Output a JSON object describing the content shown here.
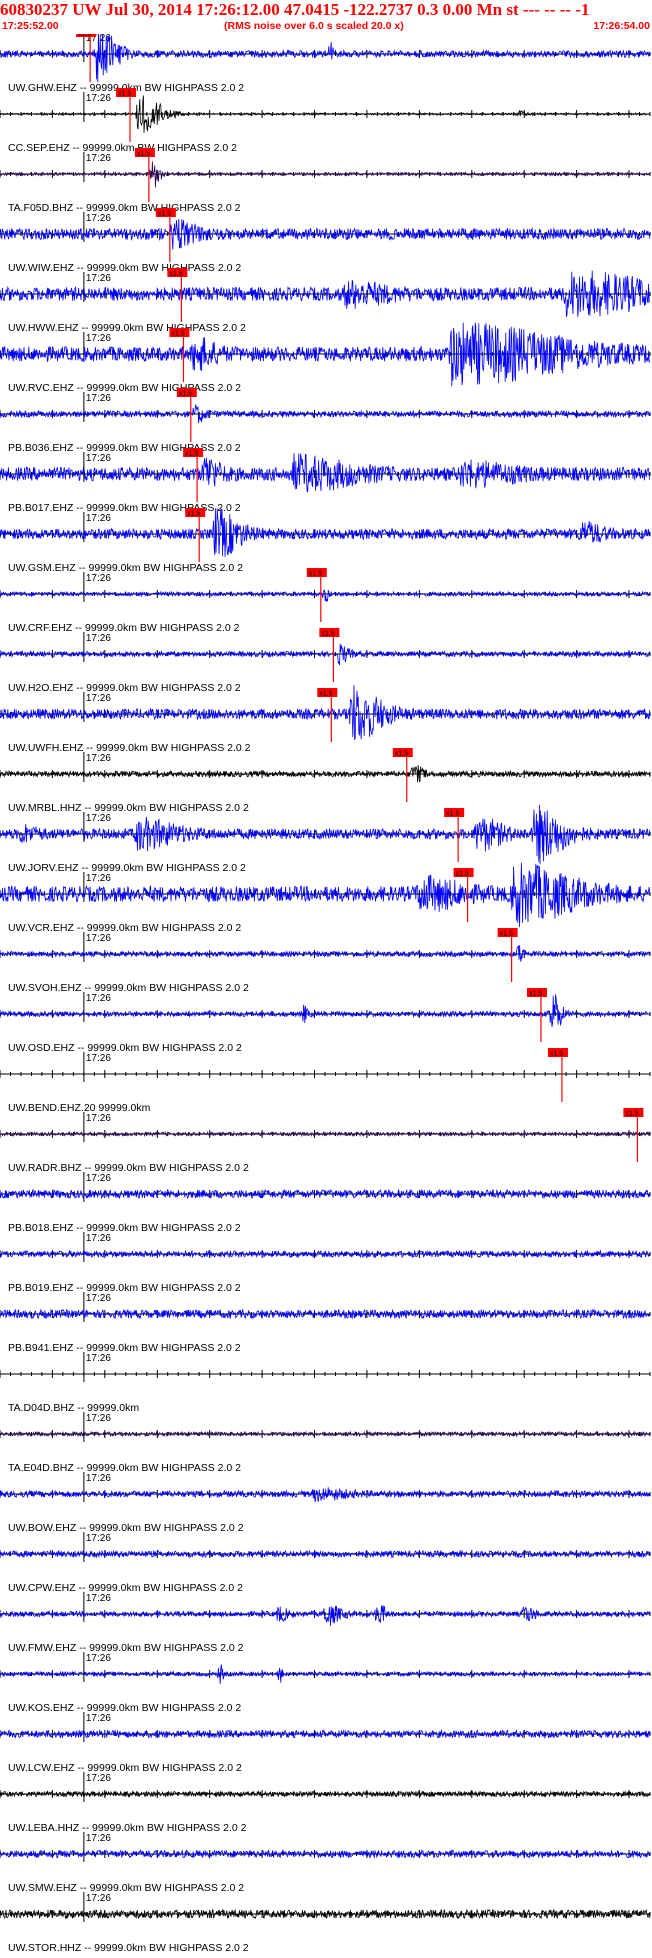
{
  "header": {
    "title": "60830237 UW Jul 30, 2014 17:26:12.00   47.0415 -122.2737  0.3 0.00 Mn st --- -- --  -1",
    "start_time": "17:25:52.00",
    "noise_note": "(RMS noise over 6.0 s scaled 20.0 x)",
    "end_time": "17:26:54.00"
  },
  "chart_data": {
    "type": "line",
    "title": "60830237 UW Jul 30, 2014 17:26:12.00   47.0415 -122.2737  0.3 0.00 Mn st --- -- --  -1",
    "x_range_seconds": [
      0,
      62
    ],
    "minute_tick_label": "17:26",
    "minute_tick_second": 8.0,
    "pick_label": "x1.5",
    "colors": {
      "blue": "#0000ff",
      "black": "#000000",
      "purple": "#2a0a5a",
      "pick": "#ff0000",
      "axis": "#000000"
    },
    "series": [
      {
        "name": "UW.GHW.EHZ -- 99999.0km BW  HIGHPASS  2.0  2",
        "color": "blue",
        "pick": 8.6,
        "noise": 0.13,
        "events": [
          {
            "t": 9.2,
            "a": 1.0,
            "d": 2.0
          },
          {
            "t": 31.5,
            "a": 0.35,
            "d": 0.4
          }
        ]
      },
      {
        "name": "CC.SEP.EHZ -- 99999.0km BW  HIGHPASS  2.0  2",
        "color": "black",
        "pick": 12.4,
        "noise": 0.04,
        "events": [
          {
            "t": 13.2,
            "a": 0.75,
            "d": 2.5
          },
          {
            "t": 49.5,
            "a": 0.08,
            "d": 1.5
          }
        ]
      },
      {
        "name": "TA.F05D.BHZ -- 99999.0km BW  HIGHPASS  2.0  2",
        "color": "purple",
        "pick": 14.2,
        "noise": 0.06,
        "events": [
          {
            "t": 14.5,
            "a": 0.55,
            "d": 0.8
          }
        ]
      },
      {
        "name": "UW.WIW.EHZ -- 99999.0km BW  HIGHPASS  2.0  2",
        "color": "blue",
        "pick": 16.2,
        "noise": 0.22,
        "events": [
          {
            "t": 16.5,
            "a": 0.45,
            "d": 2.0
          }
        ]
      },
      {
        "name": "UW.HWW.EHZ -- 99999.0km BW  HIGHPASS  2.0  2",
        "color": "blue",
        "pick": 17.3,
        "noise": 0.26,
        "events": [
          {
            "t": 54.0,
            "a": 0.7,
            "d": 9.0
          },
          {
            "t": 33.0,
            "a": 0.35,
            "d": 4.0
          }
        ]
      },
      {
        "name": "UW.RVC.EHZ -- 99999.0km BW  HIGHPASS  2.0  2",
        "color": "blue",
        "pick": 17.5,
        "noise": 0.28,
        "events": [
          {
            "t": 43.0,
            "a": 1.0,
            "d": 12.0
          },
          {
            "t": 18.5,
            "a": 0.5,
            "d": 2.0
          }
        ]
      },
      {
        "name": "PB.B036.EHZ -- 99999.0km BW  HIGHPASS  2.0  2",
        "color": "blue",
        "pick": 18.2,
        "noise": 0.12,
        "events": [
          {
            "t": 18.6,
            "a": 0.3,
            "d": 1.0
          }
        ]
      },
      {
        "name": "PB.B017.EHZ -- 99999.0km BW  HIGHPASS  2.0  2",
        "color": "blue",
        "pick": 18.8,
        "noise": 0.26,
        "events": [
          {
            "t": 28.0,
            "a": 0.55,
            "d": 6.0
          },
          {
            "t": 19.5,
            "a": 0.55,
            "d": 1.5
          },
          {
            "t": 44.0,
            "a": 0.35,
            "d": 5.0
          }
        ]
      },
      {
        "name": "UW.GSM.EHZ -- 99999.0km BW  HIGHPASS  2.0  2",
        "color": "blue",
        "pick": 19.0,
        "noise": 0.2,
        "events": [
          {
            "t": 20.5,
            "a": 0.85,
            "d": 2.5
          },
          {
            "t": 55.5,
            "a": 0.35,
            "d": 2.0
          }
        ]
      },
      {
        "name": "UW.CRF.EHZ -- 99999.0km BW  HIGHPASS  2.0  2",
        "color": "blue",
        "pick": 30.6,
        "noise": 0.08,
        "events": [
          {
            "t": 31.0,
            "a": 0.3,
            "d": 0.4
          }
        ]
      },
      {
        "name": "UW.H2O.EHZ -- 99999.0km BW  HIGHPASS  2.0  2",
        "color": "blue",
        "pick": 31.8,
        "noise": 0.1,
        "events": [
          {
            "t": 32.3,
            "a": 0.35,
            "d": 1.0
          }
        ]
      },
      {
        "name": "UW.UWFH.EHZ -- 99999.0km BW  HIGHPASS  2.0  2",
        "color": "blue",
        "pick": 31.6,
        "noise": 0.2,
        "events": [
          {
            "t": 33.5,
            "a": 1.0,
            "d": 3.0
          }
        ]
      },
      {
        "name": "UW.MRBL.HHZ -- 99999.0km BW  HIGHPASS  2.0  2",
        "color": "black",
        "pick": 38.8,
        "noise": 0.11,
        "events": [
          {
            "t": 39.4,
            "a": 0.3,
            "d": 1.0
          }
        ]
      },
      {
        "name": "UW.JORV.EHZ -- 99999.0km BW  HIGHPASS  2.0  2",
        "color": "blue",
        "pick": 43.7,
        "noise": 0.2,
        "events": [
          {
            "t": 51.0,
            "a": 1.0,
            "d": 3.0
          },
          {
            "t": 45.5,
            "a": 0.55,
            "d": 2.5
          },
          {
            "t": 13.0,
            "a": 0.5,
            "d": 4.0
          },
          {
            "t": 2.0,
            "a": 0.25,
            "d": 1.5
          }
        ]
      },
      {
        "name": "UW.VCR.EHZ -- 99999.0km BW  HIGHPASS  2.0  2",
        "color": "blue",
        "pick": 44.6,
        "noise": 0.3,
        "events": [
          {
            "t": 49.0,
            "a": 1.0,
            "d": 6.0
          },
          {
            "t": 40.0,
            "a": 0.5,
            "d": 4.0
          }
        ]
      },
      {
        "name": "UW.SVOH.EHZ -- 99999.0km BW  HIGHPASS  2.0  2",
        "color": "blue",
        "pick": 48.8,
        "noise": 0.1,
        "events": [
          {
            "t": 49.4,
            "a": 0.35,
            "d": 0.6
          }
        ]
      },
      {
        "name": "UW.OSD.EHZ -- 99999.0km BW  HIGHPASS  2.0  2",
        "color": "blue",
        "pick": 51.6,
        "noise": 0.1,
        "events": [
          {
            "t": 52.6,
            "a": 0.9,
            "d": 0.9
          },
          {
            "t": 29.0,
            "a": 0.3,
            "d": 0.4
          }
        ]
      },
      {
        "name": "UW.BEND.EHZ.20 99999.0km",
        "color": "blue",
        "pick": 53.6,
        "flat": true,
        "noise": 0.0,
        "events": []
      },
      {
        "name": "UW.RADR.BHZ -- 99999.0km BW  HIGHPASS  2.0  2",
        "color": "purple",
        "pick": 60.8,
        "noise": 0.07,
        "events": []
      },
      {
        "name": "PB.B018.EHZ -- 99999.0km BW  HIGHPASS  2.0  2",
        "color": "blue",
        "noise": 0.16,
        "events": []
      },
      {
        "name": "PB.B019.EHZ -- 99999.0km BW  HIGHPASS  2.0  2",
        "color": "blue",
        "noise": 0.12,
        "events": []
      },
      {
        "name": "PB.B941.EHZ -- 99999.0km BW  HIGHPASS  2.0  2",
        "color": "blue",
        "noise": 0.16,
        "events": []
      },
      {
        "name": "TA.D04D.BHZ -- 99999.0km",
        "color": "blue",
        "flat": true,
        "noise": 0.0,
        "events": []
      },
      {
        "name": "TA.E04D.BHZ -- 99999.0km BW  HIGHPASS  2.0  2",
        "color": "purple",
        "noise": 0.08,
        "events": []
      },
      {
        "name": "UW.BOW.EHZ -- 99999.0km BW  HIGHPASS  2.0  2",
        "color": "blue",
        "noise": 0.12,
        "events": [
          {
            "t": 30.0,
            "a": 0.2,
            "d": 3.0
          }
        ]
      },
      {
        "name": "UW.CPW.EHZ -- 99999.0km BW  HIGHPASS  2.0  2",
        "color": "blue",
        "noise": 0.12,
        "events": []
      },
      {
        "name": "UW.FMW.EHZ -- 99999.0km BW  HIGHPASS  2.0  2",
        "color": "blue",
        "noise": 0.1,
        "events": [
          {
            "t": 31.0,
            "a": 0.4,
            "d": 1.5
          },
          {
            "t": 36.0,
            "a": 0.45,
            "d": 0.7
          },
          {
            "t": 50.0,
            "a": 0.3,
            "d": 1.0
          },
          {
            "t": 26.5,
            "a": 0.25,
            "d": 1.0
          }
        ]
      },
      {
        "name": "UW.KOS.EHZ -- 99999.0km BW  HIGHPASS  2.0  2",
        "color": "blue",
        "noise": 0.08,
        "events": [
          {
            "t": 21.0,
            "a": 0.35,
            "d": 0.3
          },
          {
            "t": 26.7,
            "a": 0.3,
            "d": 0.3
          }
        ]
      },
      {
        "name": "UW.LCW.EHZ -- 99999.0km BW  HIGHPASS  2.0  2",
        "color": "blue",
        "noise": 0.14,
        "events": []
      },
      {
        "name": "UW.LEBA.HHZ -- 99999.0km BW  HIGHPASS  2.0  2",
        "color": "black",
        "noise": 0.1,
        "events": []
      },
      {
        "name": "UW.SMW.EHZ -- 99999.0km BW  HIGHPASS  2.0  2",
        "color": "blue",
        "noise": 0.14,
        "events": []
      },
      {
        "name": "UW.STOR.HHZ -- 99999.0km BW  HIGHPASS  2.0  2",
        "color": "black",
        "noise": 0.16,
        "events": []
      }
    ]
  }
}
